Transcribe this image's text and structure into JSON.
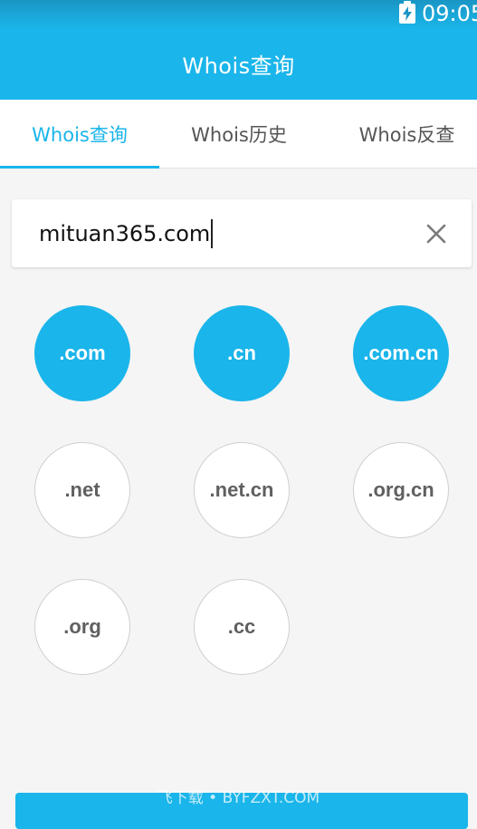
{
  "status_bar": {
    "time": "09:05",
    "battery_icon": "battery-charging-icon"
  },
  "app_bar": {
    "title": "Whois查询"
  },
  "tabs": [
    {
      "label": "Whois查询",
      "active": true
    },
    {
      "label": "Whois历史",
      "active": false
    },
    {
      "label": "Whois反查",
      "active": false
    }
  ],
  "search": {
    "value": "mituan365.com",
    "clear_icon": "close-icon"
  },
  "tlds": [
    {
      "label": ".com",
      "selected": true
    },
    {
      "label": ".cn",
      "selected": true
    },
    {
      "label": ".com.cn",
      "selected": true
    },
    {
      "label": ".net",
      "selected": false
    },
    {
      "label": ".net.cn",
      "selected": false
    },
    {
      "label": ".org.cn",
      "selected": false
    },
    {
      "label": ".org",
      "selected": false
    },
    {
      "label": ".cc",
      "selected": false
    }
  ],
  "watermark": "飞下载 • BYFZXT.COM",
  "colors": {
    "accent": "#1ab5ea",
    "background": "#f5f5f5",
    "unselected_text": "#606060"
  }
}
